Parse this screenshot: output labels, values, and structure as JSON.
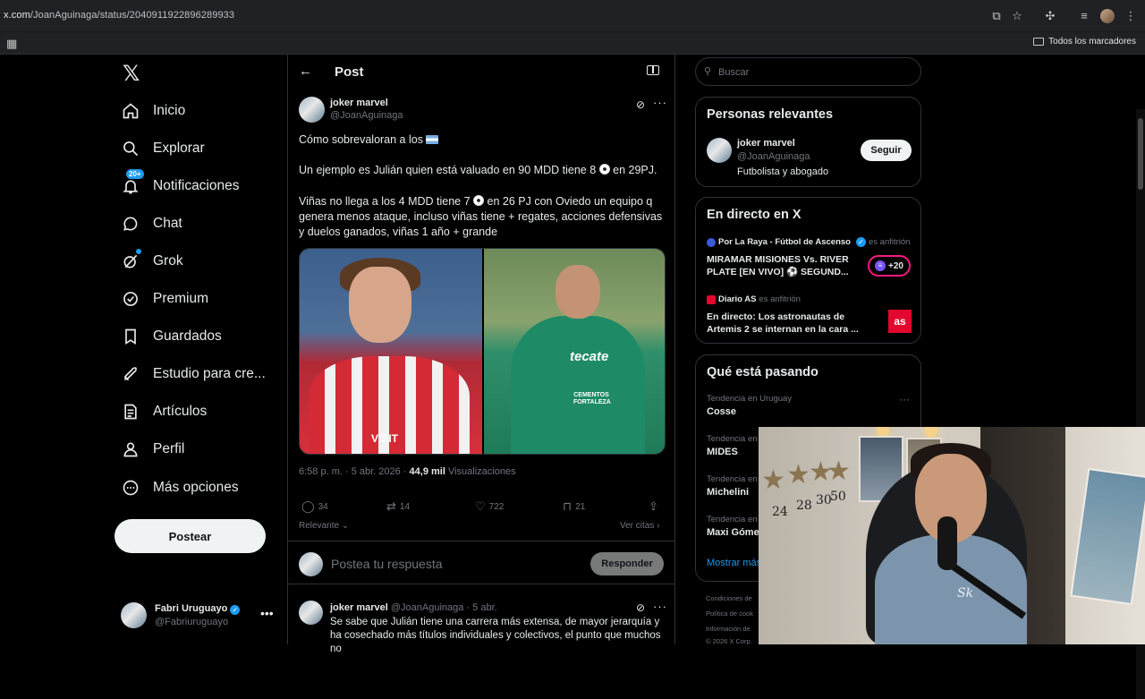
{
  "browser": {
    "url_host": "x.com",
    "url_path": "/JoanAguinaga/status/2040911922896289933",
    "bookmarks_label": "Todos los marcadores"
  },
  "nav": {
    "items": [
      {
        "label": "Inicio",
        "icon": "home-icon"
      },
      {
        "label": "Explorar",
        "icon": "search-icon"
      },
      {
        "label": "Notificaciones",
        "icon": "bell-icon",
        "badge": "20+"
      },
      {
        "label": "Chat",
        "icon": "chat-icon"
      },
      {
        "label": "Grok",
        "icon": "grok-icon"
      },
      {
        "label": "Premium",
        "icon": "premium-icon"
      },
      {
        "label": "Guardados",
        "icon": "bookmark-icon"
      },
      {
        "label": "Estudio para cre...",
        "icon": "rocket-icon"
      },
      {
        "label": "Artículos",
        "icon": "article-icon"
      },
      {
        "label": "Perfil",
        "icon": "profile-icon"
      },
      {
        "label": "Más opciones",
        "icon": "more-circle-icon"
      }
    ],
    "post_button": "Postear",
    "account": {
      "name": "Fabri Uruguayo",
      "handle": "@Fabriuruguayo"
    }
  },
  "main": {
    "header_title": "Post",
    "tweet": {
      "name": "joker marvel",
      "handle": "@JoanAguinaga",
      "line1": "Cómo sobrevaloran a los",
      "line2_a": "Un ejemplo es Julián quien está valuado en 90 MDD tiene 8",
      "line2_b": "en 29PJ.",
      "line3_a": "Viñas no llega a los 4 MDD tiene 7",
      "line3_b": "en 26 PJ con Oviedo un equipo q genera menos ataque, incluso viñas tiene + regates, acciones defensivas y duelos ganados, viñas 1 año + grande",
      "time": "6:58 p. m. · 5 abr. 2026 ·",
      "views_count": "44,9 mil",
      "views_label": "Visualizaciones",
      "replies": "34",
      "reposts": "14",
      "likes": "722",
      "bookmarks": "21",
      "media_left_text": "VISIT",
      "media_right_text": "tecate",
      "media_right_sponsor": "CEMENTOS FORTALEZA"
    },
    "sort_label": "Relevante",
    "quotes_label": "Ver citas",
    "reply_placeholder": "Postea tu respuesta",
    "reply_button": "Responder",
    "reply": {
      "name": "joker marvel",
      "handle": "@JoanAguinaga · 5 abr.",
      "text": "Se sabe que Julián tiene una carrera más extensa, de mayor jerarquía y ha cosechado más títulos individuales y colectivos, el punto que muchos no"
    }
  },
  "right": {
    "search_placeholder": "Buscar",
    "relevant": {
      "title": "Personas relevantes",
      "name": "joker marvel",
      "handle": "@JoanAguinaga",
      "bio": "Futbolista y abogado",
      "follow": "Seguir"
    },
    "live": {
      "title": "En directo en X",
      "items": [
        {
          "host": "Por La Raya - Fútbol de Ascenso",
          "role": "es anfitrión",
          "title": "MIRAMAR MISIONES Vs. RIVER PLATE [EN VIVO] ⚽ SEGUND...",
          "count": "+20"
        },
        {
          "host": "Diario AS",
          "role": "es anfitrión",
          "title": "En directo: Los astronautas de Artemis 2 se internan en la cara ...",
          "logo": "as"
        }
      ]
    },
    "trends": {
      "title": "Qué está pasando",
      "items": [
        {
          "label": "Tendencia en Uruguay",
          "topic": "Cosse"
        },
        {
          "label": "Tendencia en",
          "topic": "MIDES"
        },
        {
          "label": "Tendencia en",
          "topic": "Michelini"
        },
        {
          "label": "Tendencia en",
          "topic": "Maxi Góme"
        }
      ],
      "show_more": "Mostrar más"
    },
    "footer": [
      "Condiciones de",
      "Política de cook",
      "Información de",
      "© 2026 X Corp."
    ]
  },
  "webcam": {
    "numbers": [
      "24",
      "28",
      "30",
      "50"
    ],
    "shirt_text": "Sk"
  }
}
